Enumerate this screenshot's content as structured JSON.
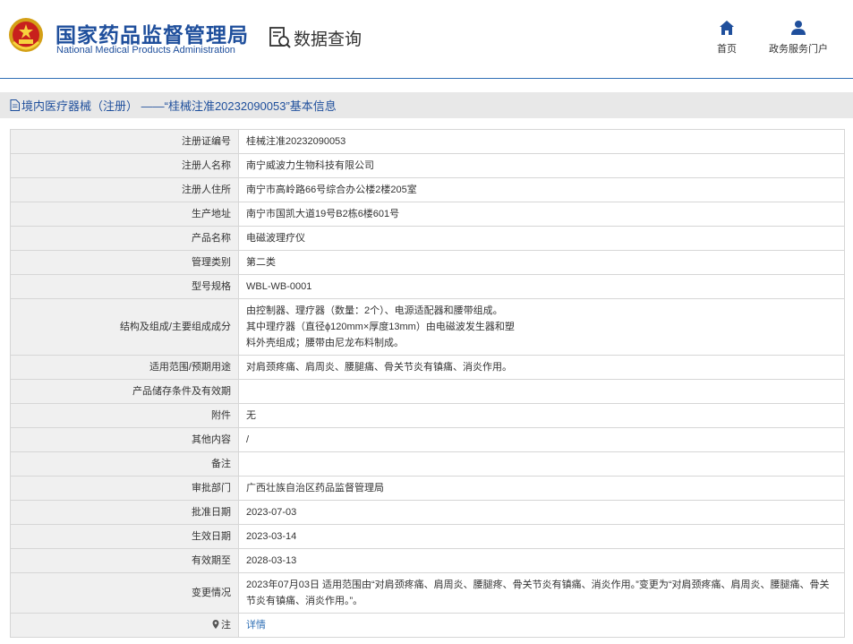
{
  "header": {
    "logo_cn": "国家药品监督管理局",
    "logo_en": "National Medical Products Administration",
    "query_label": "数据查询",
    "nav": [
      {
        "label": "首页",
        "icon": "home-icon"
      },
      {
        "label": "政务服务门户",
        "icon": "user-icon"
      }
    ]
  },
  "title": "境内医疗器械（注册） ——“桂械注准20232090053”基本信息",
  "rows": [
    {
      "label": "注册证编号",
      "value": "桂械注准20232090053"
    },
    {
      "label": "注册人名称",
      "value": "南宁威波力生物科技有限公司"
    },
    {
      "label": "注册人住所",
      "value": "南宁市高岭路66号综合办公楼2楼205室"
    },
    {
      "label": "生产地址",
      "value": "南宁市国凯大道19号B2栋6楼601号"
    },
    {
      "label": "产品名称",
      "value": "电磁波理疗仪"
    },
    {
      "label": "管理类别",
      "value": "第二类"
    },
    {
      "label": "型号规格",
      "value": "WBL-WB-0001"
    },
    {
      "label": "结构及组成/主要组成成分",
      "value_lines": [
        "由控制器、理疗器（数量：2个）、电源适配器和腰带组成。",
        "其中理疗器（直径ϕ120mm×厚度13mm）由电磁波发生器和塑",
        "料外壳组成；腰带由尼龙布料制成。"
      ]
    },
    {
      "label": "适用范围/预期用途",
      "value": "对肩颈疼痛、肩周炎、腰腿痛、骨关节炎有镇痛、消炎作用。"
    },
    {
      "label": "产品储存条件及有效期",
      "value": ""
    },
    {
      "label": "附件",
      "value": "无"
    },
    {
      "label": "其他内容",
      "value": "/"
    },
    {
      "label": "备注",
      "value": ""
    },
    {
      "label": "审批部门",
      "value": "广西壮族自治区药品监督管理局"
    },
    {
      "label": "批准日期",
      "value": "2023-07-03"
    },
    {
      "label": "生效日期",
      "value": "2023-03-14"
    },
    {
      "label": "有效期至",
      "value": "2028-03-13"
    },
    {
      "label": "变更情况",
      "value": "2023年07月03日 适用范围由“对肩颈疼痛、肩周炎、腰腿疼、骨关节炎有镇痛、消炎作用。”变更为“对肩颈疼痛、肩周炎、腰腿痛、骨关节炎有镇痛、消炎作用。”。"
    },
    {
      "label": "注",
      "value": "详情",
      "icon": "pin-icon"
    }
  ]
}
